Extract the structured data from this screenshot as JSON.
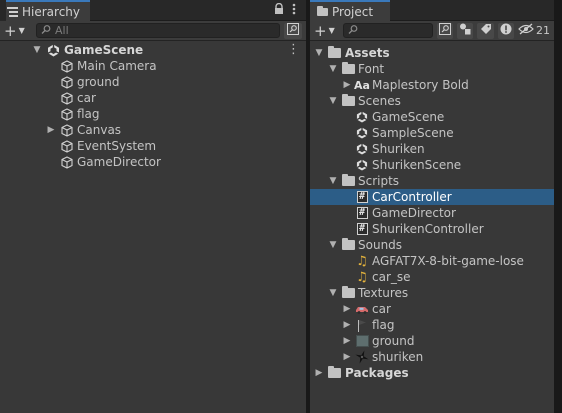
{
  "hierarchy": {
    "tab_label": "Hierarchy",
    "search_placeholder": "All",
    "add_label": "+",
    "scene": {
      "label": "GameScene"
    },
    "items": [
      {
        "label": "Main Camera"
      },
      {
        "label": "ground"
      },
      {
        "label": "car"
      },
      {
        "label": "flag"
      },
      {
        "label": "Canvas"
      },
      {
        "label": "EventSystem"
      },
      {
        "label": "GameDirector"
      }
    ]
  },
  "project": {
    "tab_label": "Project",
    "add_label": "+",
    "search_value": "",
    "visibility_count": "21",
    "tree": {
      "assets": "Assets",
      "font": {
        "label": "Font",
        "items": [
          {
            "prefix": "Aa",
            "label": "Maplestory Bold"
          }
        ]
      },
      "scenes": {
        "label": "Scenes",
        "items": [
          {
            "label": "GameScene"
          },
          {
            "label": "SampleScene"
          },
          {
            "label": "Shuriken"
          },
          {
            "label": "ShurikenScene"
          }
        ]
      },
      "scripts": {
        "label": "Scripts",
        "items": [
          {
            "label": "CarController"
          },
          {
            "label": "GameDirector"
          },
          {
            "label": "ShurikenController"
          }
        ]
      },
      "sounds": {
        "label": "Sounds",
        "items": [
          {
            "label": "AGFAT7X-8-bit-game-lose"
          },
          {
            "label": "car_se"
          }
        ]
      },
      "textures": {
        "label": "Textures",
        "items": [
          {
            "label": "car"
          },
          {
            "label": "flag"
          },
          {
            "label": "ground"
          },
          {
            "label": "shuriken"
          }
        ]
      },
      "packages": "Packages"
    }
  },
  "colors": {
    "accent_tab": "#3a79bb",
    "selection": "#2c5d87",
    "panel_bg": "#383838",
    "tab_strip": "#282828"
  },
  "icons": {
    "scene": "unity-logo-icon",
    "gameobject": "cube-icon",
    "folder": "folder-icon",
    "script": "csharp-script-icon",
    "audio": "audio-note-icon",
    "lock": "lock-icon",
    "menu": "kebab-menu-icon"
  }
}
